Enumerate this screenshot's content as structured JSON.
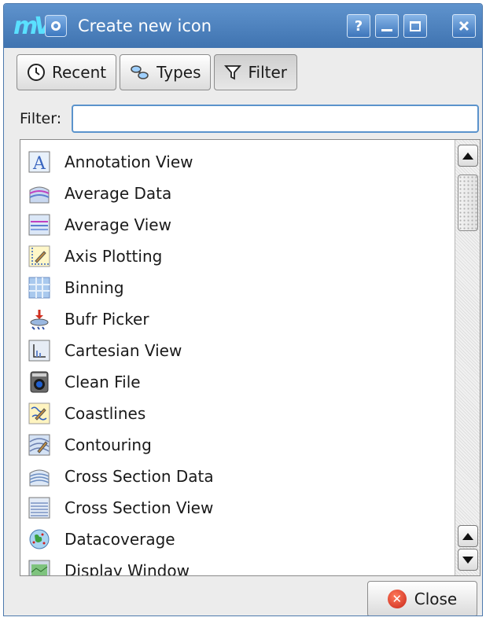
{
  "window": {
    "title": "Create new icon",
    "help_label": "?",
    "logo_text": "mV"
  },
  "tabs": [
    {
      "label": "Recent",
      "icon": "clock-icon",
      "active": false
    },
    {
      "label": "Types",
      "icon": "types-icon",
      "active": false
    },
    {
      "label": "Filter",
      "icon": "funnel-icon",
      "active": true
    }
  ],
  "filter": {
    "label": "Filter:",
    "value": ""
  },
  "items": [
    {
      "label": "Annotation View",
      "icon": "annotation-view-icon"
    },
    {
      "label": "Average Data",
      "icon": "average-data-icon"
    },
    {
      "label": "Average View",
      "icon": "average-view-icon"
    },
    {
      "label": "Axis Plotting",
      "icon": "axis-plotting-icon"
    },
    {
      "label": "Binning",
      "icon": "binning-icon"
    },
    {
      "label": "Bufr Picker",
      "icon": "bufr-picker-icon"
    },
    {
      "label": "Cartesian View",
      "icon": "cartesian-view-icon"
    },
    {
      "label": "Clean File",
      "icon": "clean-file-icon"
    },
    {
      "label": "Coastlines",
      "icon": "coastlines-icon"
    },
    {
      "label": "Contouring",
      "icon": "contouring-icon"
    },
    {
      "label": "Cross Section Data",
      "icon": "cross-section-data-icon"
    },
    {
      "label": "Cross Section View",
      "icon": "cross-section-view-icon"
    },
    {
      "label": "Datacoverage",
      "icon": "datacoverage-icon"
    },
    {
      "label": "Display Window",
      "icon": "display-window-icon"
    }
  ],
  "footer": {
    "close_label": "Close"
  },
  "colors": {
    "titlebar": "#4a80bf",
    "accent": "#5a93cc",
    "close_red": "#d2352a"
  }
}
